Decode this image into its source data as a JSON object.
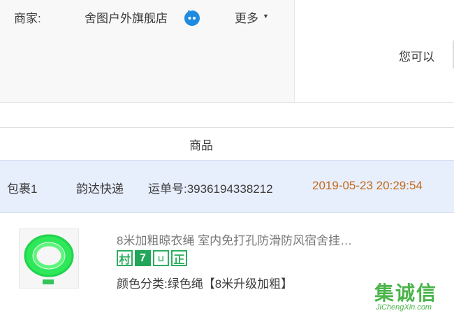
{
  "header": {
    "merchant_label": "商家:",
    "merchant_name": "舍图户外旗舰店",
    "more_label": "更多",
    "you_can_text": "您可以"
  },
  "table": {
    "column_title": "商品"
  },
  "package": {
    "label": "包裹1",
    "carrier": "韵达快递",
    "waybill": "运单号:3936194338212",
    "time": "2019-05-23 20:29:54"
  },
  "product": {
    "title": "8米加粗晾衣绳 室内免打孔防滑防风宿舍挂…",
    "sku": "颜色分类:绿色绳【8米升级加粗】",
    "badges": [
      "村",
      "7",
      "⊔",
      "正"
    ]
  },
  "watermark": {
    "logo": "集诚信",
    "url": "JiChengXin.com"
  },
  "colors": {
    "time": "#c46a1b",
    "package_bg": "#e7eefc",
    "badge_green": "#2cad5e"
  }
}
